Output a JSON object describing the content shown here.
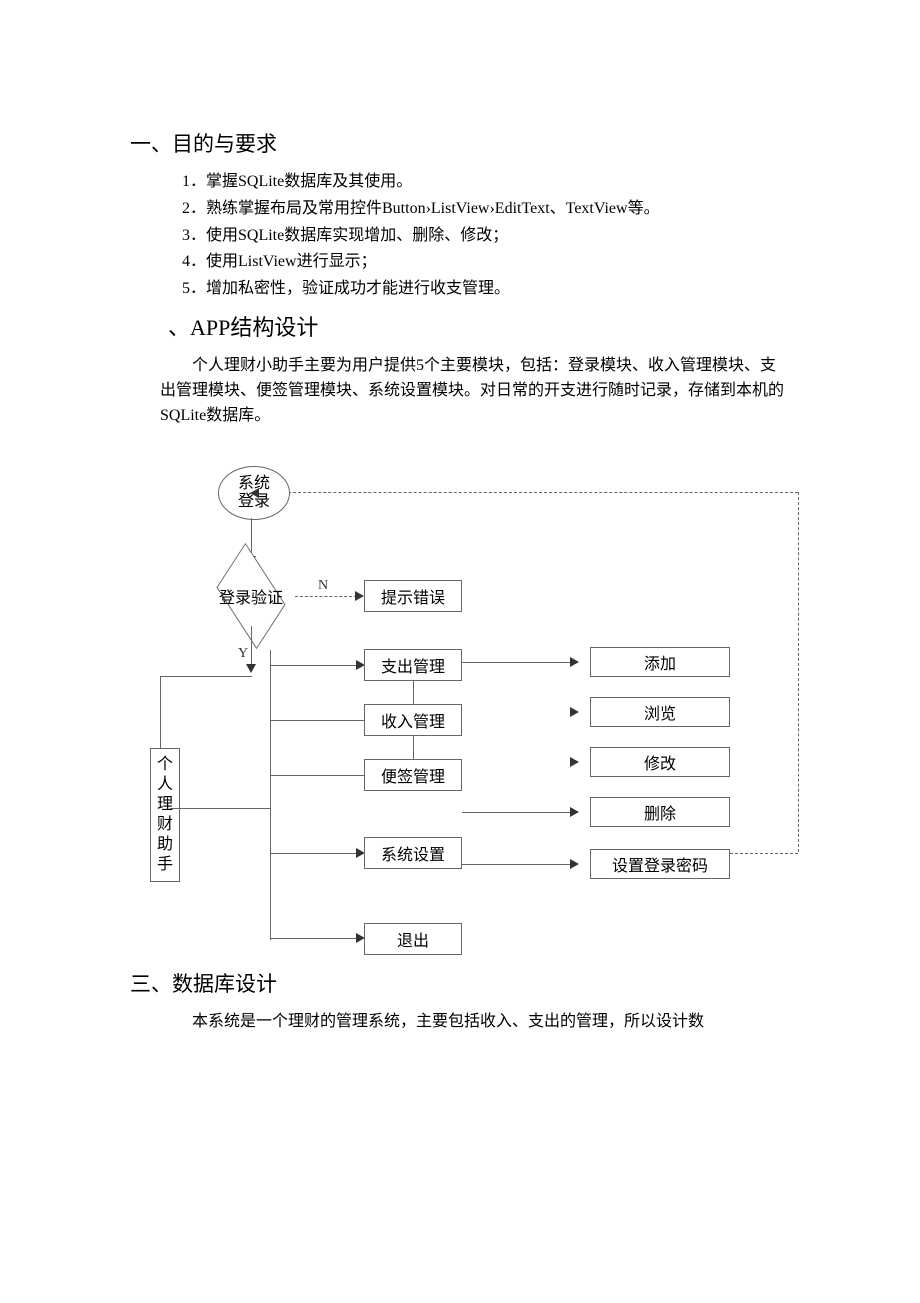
{
  "section1": {
    "title": "一、目的与要求",
    "items": [
      "1．掌握SQLite数据库及其使用。",
      "2．熟练掌握布局及常用控件Button›ListView›EditText、TextView等。",
      "3．使用SQLite数据库实现增加、删除、修改；",
      "4．使用ListView进行显示；",
      "5．增加私密性，验证成功才能进行收支管理。"
    ]
  },
  "section2": {
    "title": "、APP结构设计",
    "para1": "个人理财小助手主要为用户提供5个主要模块，包括：登录模块、收入管理模块、支出管理模块、便签管理模块、系统设置模块。对日常的开支进行随时记录，存储到本机的SQLite数据库。"
  },
  "diagram": {
    "sys_login": "系统\n登录",
    "login_verify": "登录验证",
    "error_hint": "提示错误",
    "N": "N",
    "Y": "Y",
    "assistant": "个人理财助手",
    "expense": "支出管理",
    "income": "收入管理",
    "memo": "便签管理",
    "settings": "系统设置",
    "exit": "退出",
    "add": "添加",
    "browse": "浏览",
    "modify": "修改",
    "delete": "删除",
    "set_pwd": "设置登录密码"
  },
  "section3": {
    "title": "三、数据库设计",
    "para1": "本系统是一个理财的管理系统，主要包括收入、支出的管理，所以设计数"
  }
}
